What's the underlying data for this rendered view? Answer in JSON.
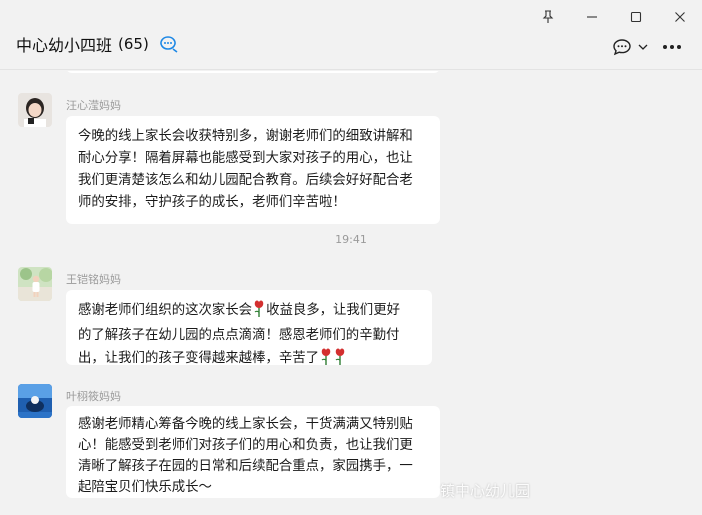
{
  "window": {
    "pin_icon": "pin-icon",
    "minimize_icon": "minimize-icon",
    "maximize_icon": "maximize-icon",
    "close_icon": "close-icon"
  },
  "header": {
    "title": "中心幼小四班",
    "member_count": "(65)",
    "group_icon": "group-chat-icon",
    "chat_options_icon": "chat-bubble-options-icon",
    "dropdown_icon": "chevron-down-icon",
    "more_icon": "more-icon"
  },
  "messages": [
    {
      "sender": "汪心滢妈妈",
      "lines": [
        "今晚的线上家长会收获特别多，谢谢老师们的细致讲解和",
        "耐心分享！隔着屏幕也能感受到大家对孩子的用心，也让",
        "我们更清楚该怎么和幼儿园配合教育。后续会好好配合老",
        "师的安排，守护孩子的成长，老师们辛苦啦！"
      ]
    },
    {
      "sender": "王铠铭妈妈",
      "lines": [
        "感谢老师们组织的这次家长会",
        "收益良多，让我们更好",
        "的了解孩子在幼儿园的点点滴滴！感恩老师们的辛勤付",
        "出，让我们的孩子变得越来越棒，辛苦了"
      ]
    },
    {
      "sender": "叶栩筱妈妈",
      "lines": [
        "感谢老师精心筹备今晚的线上家长会，干货满满又特别贴",
        "心！能感受到老师们对孩子们的用心和负责，也让我们更",
        "清晰了解孩子在园的日常和后续配合重点，家园携手，一",
        "起陪宝贝们快乐成长～"
      ]
    }
  ],
  "timestamp": "19:41",
  "watermark": "镇中心幼儿园",
  "colors": {
    "background": "#f2f2f2",
    "bubble": "#ffffff",
    "accent": "#1e88e5",
    "rose": "#d32f2f"
  }
}
